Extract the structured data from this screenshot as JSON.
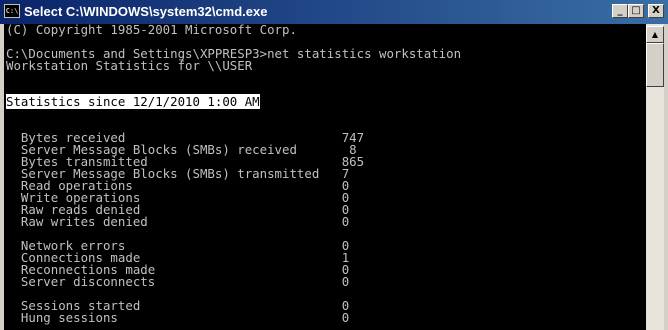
{
  "window": {
    "title": "Select C:\\WINDOWS\\system32\\cmd.exe",
    "icon_label": "C:\\",
    "minimize_glyph": "_",
    "maximize_glyph": "□",
    "close_glyph": "X"
  },
  "console": {
    "lines": [
      "(C) Copyright 1985-2001 Microsoft Corp.",
      "",
      "C:\\Documents and Settings\\XPPRESP3>net statistics workstation",
      "Workstation Statistics for \\\\USER",
      "",
      "",
      "Statistics since 12/1/2010 1:00 AM",
      "",
      "",
      "  Bytes received                             747",
      "  Server Message Blocks (SMBs) received       8",
      "  Bytes transmitted                          865",
      "  Server Message Blocks (SMBs) transmitted   7",
      "  Read operations                            0",
      "  Write operations                           0",
      "  Raw reads denied                           0",
      "  Raw writes denied                          0",
      "",
      "  Network errors                             0",
      "  Connections made                           1",
      "  Reconnections made                         0",
      "  Server disconnects                         0",
      "",
      "  Sessions started                           0",
      "  Hung sessions                              0"
    ],
    "selected_line": "Statistics since 12/1/2010 1:00 AM"
  },
  "scrollbar": {
    "up_glyph": "▲"
  },
  "colors": {
    "titlebar_start": "#0a246a",
    "titlebar_end": "#3a6ea5",
    "console_bg": "#000000",
    "console_text": "#c0c0c0",
    "selection_bg": "#ffffff",
    "selection_text": "#000000"
  }
}
